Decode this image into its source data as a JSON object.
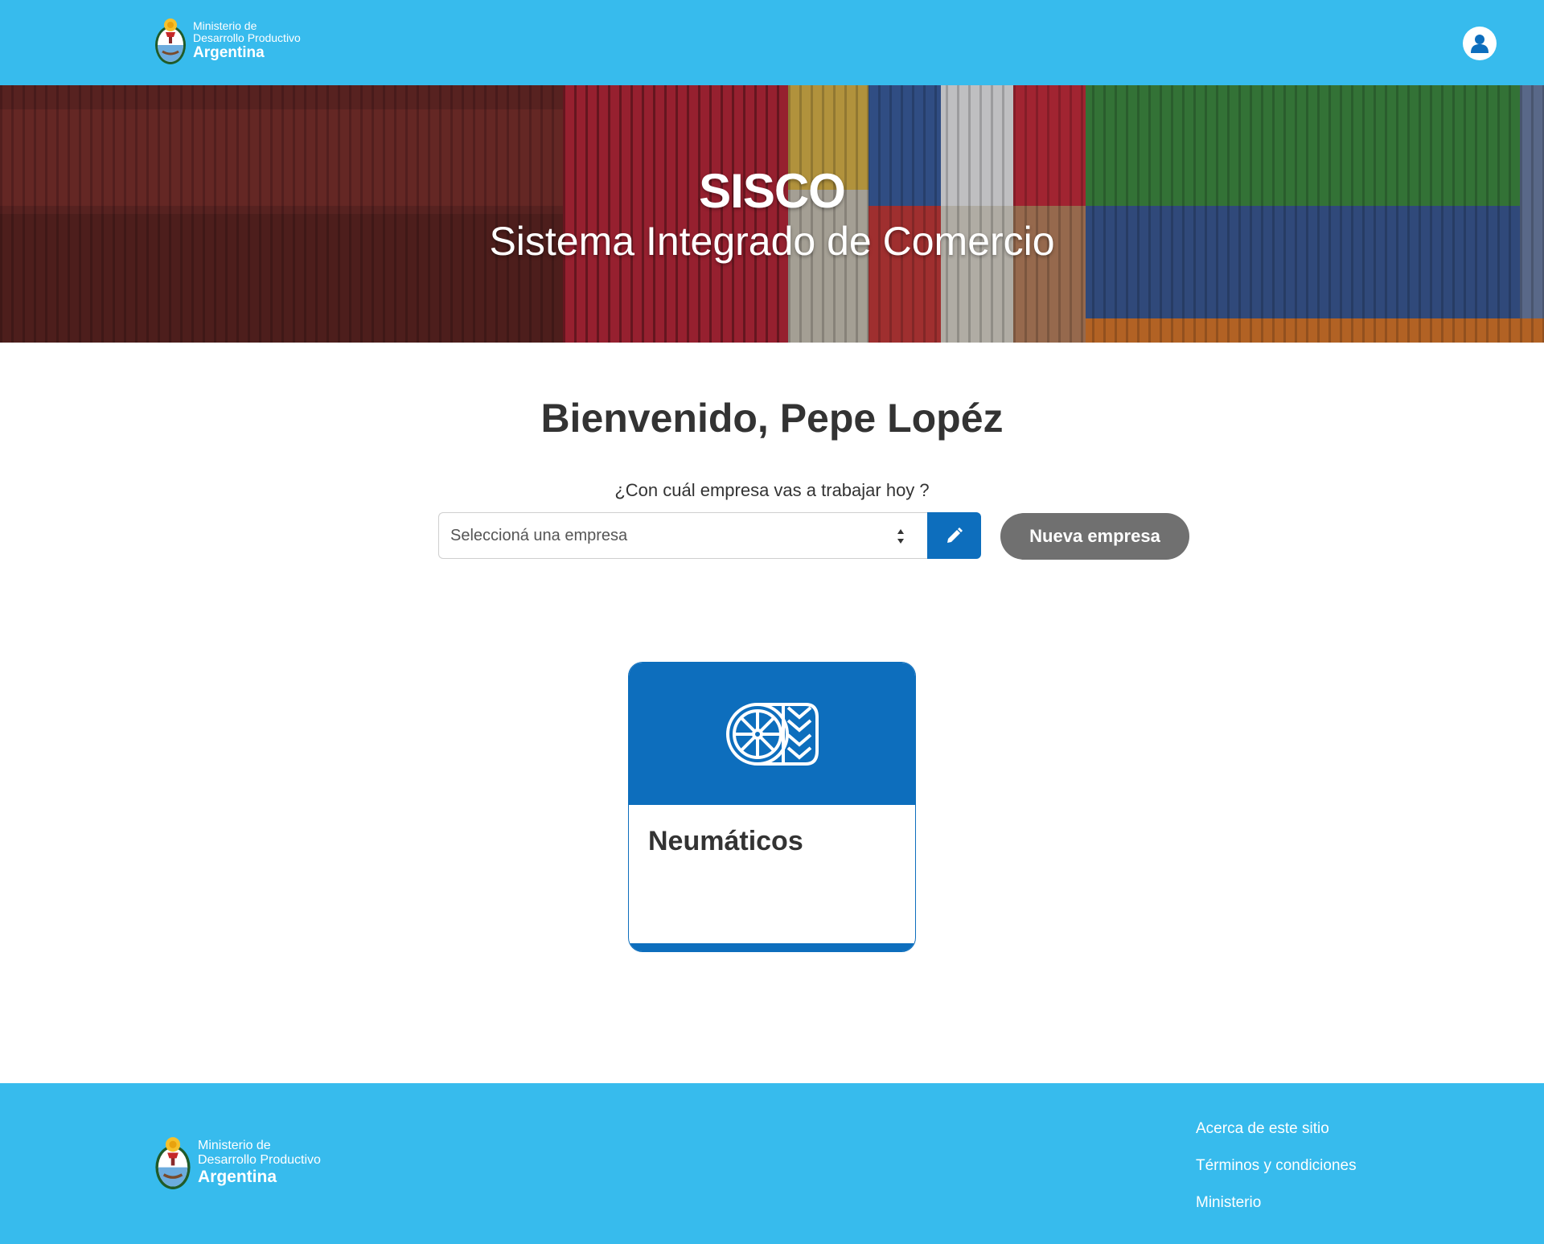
{
  "header": {
    "brand": {
      "line1": "Ministerio de",
      "line2": "Desarrollo Productivo",
      "line3": "Argentina"
    },
    "user_icon": "user-icon"
  },
  "hero": {
    "title": "SISCO",
    "subtitle": "Sistema Integrado de Comercio"
  },
  "main": {
    "welcome": "Bienvenido, Pepe Lopéz",
    "question": "¿Con cuál empresa vas a trabajar hoy ?",
    "company_select": {
      "placeholder": "Seleccioná una empresa"
    },
    "edit_icon": "pencil-icon",
    "new_company_label": "Nueva empresa"
  },
  "cards": [
    {
      "title": "Neumáticos",
      "icon": "tire-icon"
    }
  ],
  "footer": {
    "brand": {
      "line1": "Ministerio de",
      "line2": "Desarrollo Productivo",
      "line3": "Argentina"
    },
    "links": [
      "Acerca de este sitio",
      "Términos y condiciones",
      "Ministerio"
    ]
  },
  "colors": {
    "header_bg": "#37BBED",
    "primary": "#0D6EBD",
    "secondary_button": "#707070",
    "text": "#333333"
  }
}
